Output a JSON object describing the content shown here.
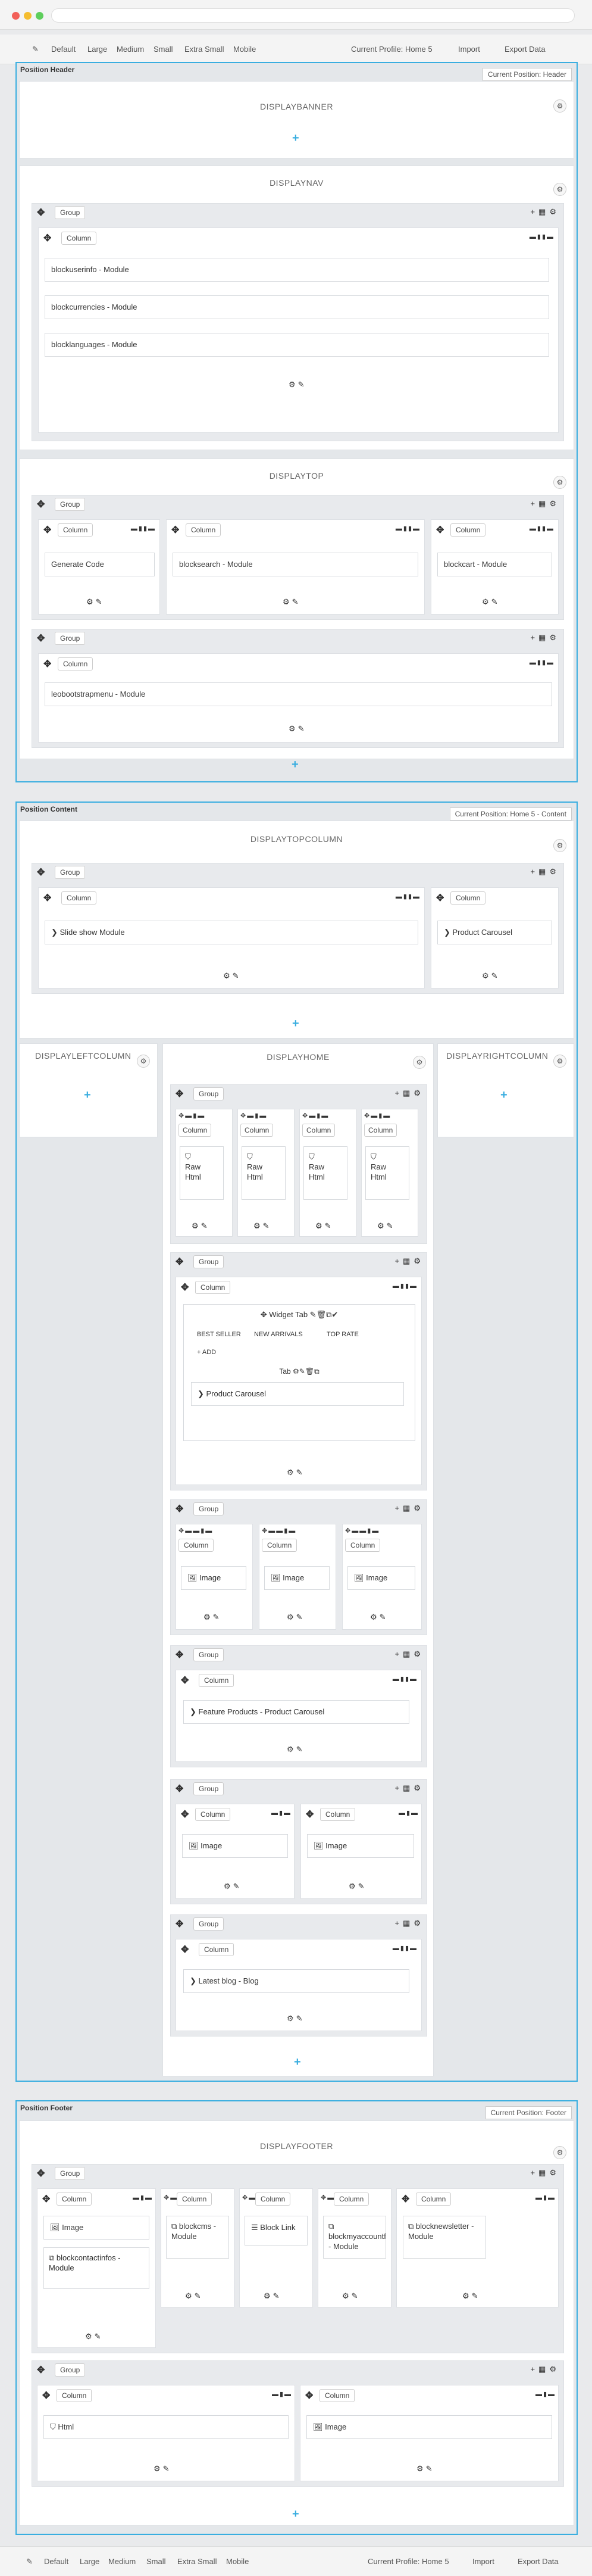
{
  "toolbar": {
    "default": "Default",
    "large": "Large",
    "medium": "Medium",
    "small": "Small",
    "extra_small": "Extra Small",
    "mobile": "Mobile",
    "profile": "Current Profile: Home 5",
    "import": "Import",
    "export": "Export Data"
  },
  "header": {
    "label": "Position Header",
    "btn": "Current Position: Header"
  },
  "content": {
    "label": "Position Content",
    "btn": "Current Position: Home 5 - Content"
  },
  "footer": {
    "label": "Position Footer",
    "btn": "Current Position: Footer"
  },
  "hooks": {
    "banner": "DISPLAYBANNER",
    "nav": "DISPLAYNAV",
    "top": "DISPLAYTOP",
    "topcolumn": "DISPLAYTOPCOLUMN",
    "left": "DISPLAYLEFTCOLUMN",
    "home": "DISPLAYHOME",
    "right": "DISPLAYRIGHTCOLUMN",
    "footer": "DISPLAYFOOTER"
  },
  "labels": {
    "group": "Group",
    "column": "Column",
    "widget_tab": "Widget Tab",
    "tab": "Tab",
    "add": "ADD"
  },
  "tabs": [
    "BEST SELLER",
    "NEW ARRIVALS",
    "TOP RATE"
  ],
  "modules": {
    "nav": [
      "blockuserinfo - Module",
      "blockcurrencies - Module",
      "blocklanguages - Module"
    ],
    "top": [
      "Generate Code",
      "blocksearch - Module",
      "blockcart - Module"
    ],
    "megamenu": "leobootstrapmenu - Module",
    "slideshow": "Slide show Module",
    "carousel": "Product Carousel",
    "rawhtml": "Raw Html",
    "image": "Image",
    "feature": "Feature Products - Product Carousel",
    "blog": "Latest blog - Blog",
    "footer": [
      "Image",
      "blockcms - Module",
      "Block Link",
      "blockmyaccountfooter - Module",
      "blocknewsletter - Module"
    ],
    "contact": "blockcontactinfos - Module",
    "html": "Html"
  }
}
